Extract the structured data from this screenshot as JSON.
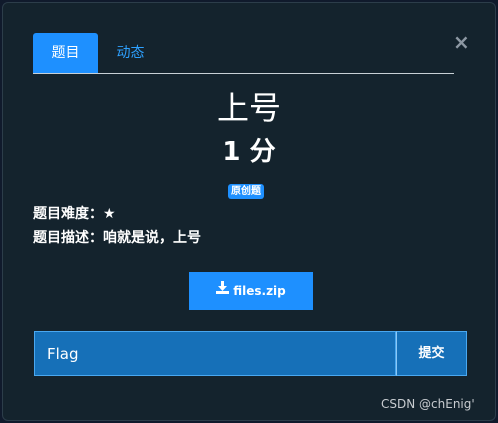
{
  "tabs": [
    {
      "label": "题目",
      "active": true
    },
    {
      "label": "动态",
      "active": false
    }
  ],
  "close_icon": "close-icon",
  "challenge": {
    "name": "上号",
    "value": "1 分",
    "badge": "原创题",
    "difficulty_label": "题目难度：",
    "difficulty_value": "★",
    "description_label": "题目描述：",
    "description_value": "咱就是说，上号"
  },
  "download": {
    "icon": "download-icon",
    "label": "files.zip"
  },
  "flag_form": {
    "placeholder": "Flag",
    "value": "",
    "submit_label": "提交"
  },
  "watermark": "CSDN @chEnig'",
  "colors": {
    "accent": "#1e90ff",
    "background": "#14232d",
    "input_bg": "#1670b8"
  }
}
